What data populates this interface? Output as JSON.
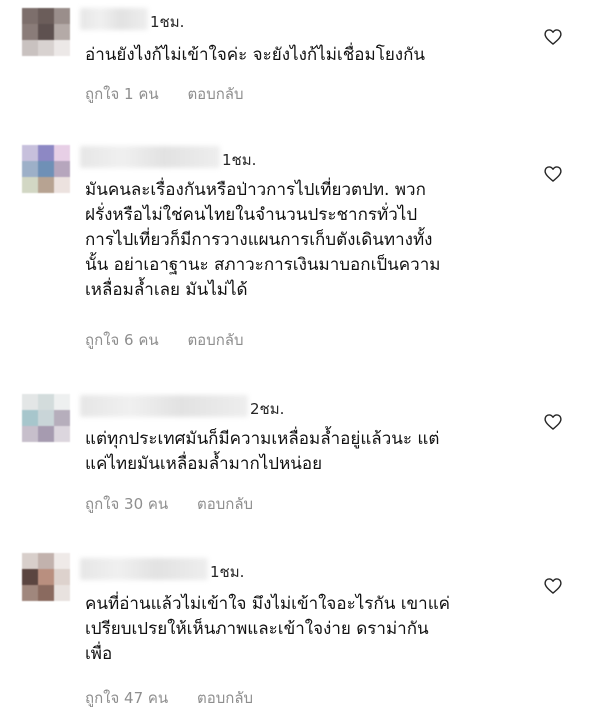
{
  "comments": [
    {
      "time": "1ชม.",
      "text": "อ่านยังไงก้ไม่เข้าใจค่ะ จะยังไงก้ไม่เชื่อมโยงกัน",
      "likes": "ถูกใจ 1 คน",
      "reply": "ตอบกลับ"
    },
    {
      "time": "1ชม.",
      "text": "มันคนละเรื่องกันหรือป่าวการไปเที่ยวตปท. พวก\nฝรั่งหรือไม่ใช่คนไทยในจำนวนประชากรทั่วไป\nการไปเที่ยวก็มีการวางแผนการเก็บตังเดินทางทั้ง\nนั้น อย่าเอาฐานะ สภาวะการเงินมาบอกเป็นความ\nเหลื่อมล้ำเลย มันไม่ได้",
      "likes": "ถูกใจ 6 คน",
      "reply": "ตอบกลับ"
    },
    {
      "time": "2ชม.",
      "text": "แต่ทุกประเทศมันก็มีความเหลื่อมล้ำอยู่แล้วนะ แต่\nแค่ไทยมันเหลื่อมล้ำมากไปหน่อย",
      "likes": "ถูกใจ 30 คน",
      "reply": "ตอบกลับ"
    },
    {
      "time": "1ชม.",
      "text": "คนที่อ่านแล้วไม่เข้าใจ มึงไม่เข้าใจอะไรกัน เขาแค่\nเปรียบเปรยให้เห็นภาพและเข้าใจง่าย ดราม่ากัน\nเพื่อ",
      "likes": "ถูกใจ 47 คน",
      "reply": "ตอบกลับ"
    }
  ],
  "icons": {
    "like": "heart-outline-icon"
  },
  "colors": {
    "text": "#111111",
    "meta": "#8e8e8e",
    "icon": "#262626"
  }
}
